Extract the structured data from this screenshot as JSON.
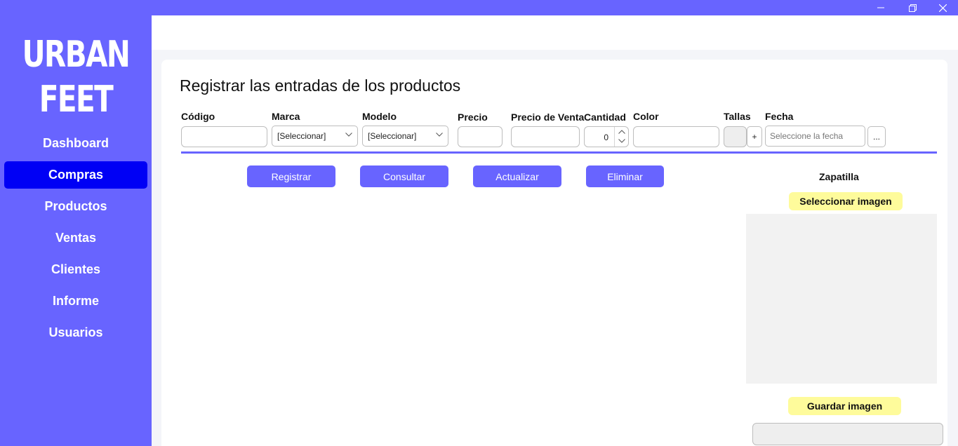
{
  "window": {
    "controls": [
      "minimize-icon",
      "restore-icon",
      "close-icon"
    ],
    "accent_color": "#6864ff"
  },
  "sidebar": {
    "logo_line1": "URBAN",
    "logo_line2": "FEET",
    "items": [
      {
        "label": "Dashboard",
        "active": false
      },
      {
        "label": "Compras",
        "active": true
      },
      {
        "label": "Productos",
        "active": false
      },
      {
        "label": "Ventas",
        "active": false
      },
      {
        "label": "Clientes",
        "active": false
      },
      {
        "label": "Informe",
        "active": false
      },
      {
        "label": "Usuarios",
        "active": false
      }
    ],
    "active_color": "#0000f5"
  },
  "form": {
    "title": "Registrar las entradas de los productos",
    "codigo_label": "Código",
    "codigo_value": "",
    "marca_label": "Marca",
    "marca_value": "[Seleccionar]",
    "modelo_label": "Modelo",
    "modelo_value": "[Seleccionar]",
    "precio_label": "Precio",
    "precio_value": "",
    "precio_venta_label": "Precio de Venta",
    "precio_venta_value": "",
    "cantidad_label": "Cantidad",
    "cantidad_value": "0",
    "color_label": "Color",
    "color_value": "",
    "tallas_label": "Tallas",
    "tallas_add": "+",
    "fecha_label": "Fecha",
    "fecha_placeholder": "Seleccione la fecha",
    "fecha_picker": "..."
  },
  "actions": {
    "registrar": "Registrar",
    "consultar": "Consultar",
    "actualizar": "Actualizar",
    "eliminar": "Eliminar"
  },
  "image_panel": {
    "title": "Zapatilla",
    "select_label": "Seleccionar imagen",
    "save_label": "Guardar imagen",
    "button_color": "#fefb9b"
  }
}
